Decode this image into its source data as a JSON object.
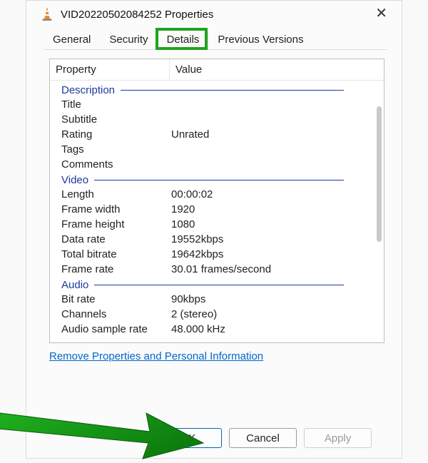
{
  "window": {
    "title": "VID20220502084252 Properties",
    "tabs": [
      "General",
      "Security",
      "Details",
      "Previous Versions"
    ],
    "active_tab": 2
  },
  "columns": {
    "property": "Property",
    "value": "Value"
  },
  "groups": [
    {
      "name": "Description",
      "rows": [
        {
          "prop": "Title",
          "val": ""
        },
        {
          "prop": "Subtitle",
          "val": ""
        },
        {
          "prop": "Rating",
          "val": "Unrated"
        },
        {
          "prop": "Tags",
          "val": ""
        },
        {
          "prop": "Comments",
          "val": ""
        }
      ]
    },
    {
      "name": "Video",
      "rows": [
        {
          "prop": "Length",
          "val": "00:00:02"
        },
        {
          "prop": "Frame width",
          "val": "1920"
        },
        {
          "prop": "Frame height",
          "val": "1080"
        },
        {
          "prop": "Data rate",
          "val": "19552kbps"
        },
        {
          "prop": "Total bitrate",
          "val": "19642kbps"
        },
        {
          "prop": "Frame rate",
          "val": "30.01 frames/second"
        }
      ]
    },
    {
      "name": "Audio",
      "rows": [
        {
          "prop": "Bit rate",
          "val": "90kbps"
        },
        {
          "prop": "Channels",
          "val": "2 (stereo)"
        },
        {
          "prop": "Audio sample rate",
          "val": "48.000 kHz"
        }
      ]
    }
  ],
  "link": "Remove Properties and Personal Information",
  "buttons": {
    "ok": "OK",
    "cancel": "Cancel",
    "apply": "Apply"
  }
}
